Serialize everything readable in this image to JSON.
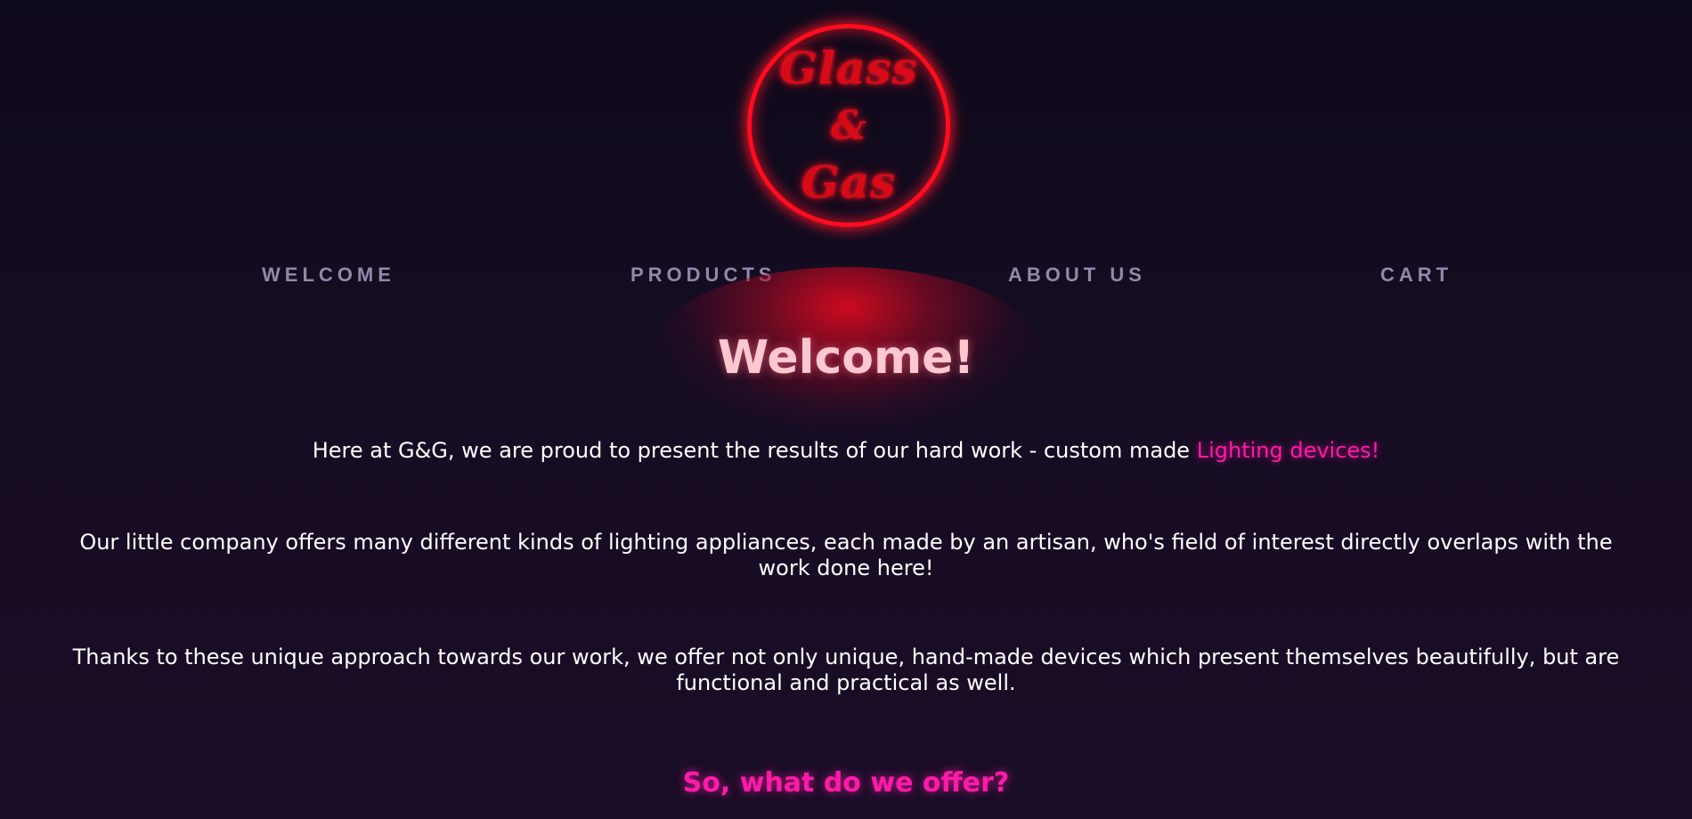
{
  "logo": {
    "line1": "Glass",
    "line2": "&",
    "line3": "Gas"
  },
  "nav": {
    "items": [
      {
        "label": "WELCOME"
      },
      {
        "label": "PRODUCTS"
      },
      {
        "label": "ABOUT US"
      },
      {
        "label": "CART"
      }
    ]
  },
  "main": {
    "title": "Welcome!",
    "intro_text": "Here at G&G, we are proud to present the results of our hard work - custom made ",
    "intro_highlight": "Lighting devices!",
    "paragraph2": "Our little company offers many different kinds of lighting appliances, each made by an artisan, who's field of interest directly overlaps with the work done here!",
    "paragraph3": "Thanks to these unique approach towards our work, we offer not only unique, hand-made devices which present themselves beautifully, but are functional and practical as well.",
    "offer_heading": "So, what do we offer?"
  },
  "colors": {
    "background": "#130b20",
    "neon_red": "#ff0d1e",
    "neon_pink": "#ff1aa8",
    "nav_text": "#9089a8",
    "title_text": "#ffc8d0"
  }
}
